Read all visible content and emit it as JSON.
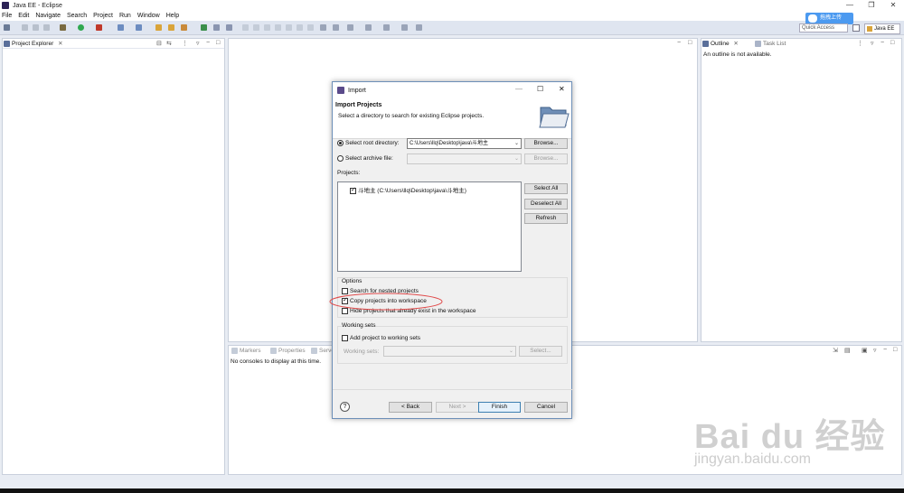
{
  "window": {
    "title": "Java EE - Eclipse",
    "minimize": "—",
    "maximize": "❐",
    "close": "✕"
  },
  "menu": [
    "File",
    "Edit",
    "Navigate",
    "Search",
    "Project",
    "Run",
    "Window",
    "Help"
  ],
  "toolbar": {
    "quick_access": "Quick Access",
    "upload_label": "拖拽上传",
    "perspective": "Java EE"
  },
  "panels": {
    "project_explorer": "Project Explorer",
    "outline_tab": "Outline",
    "task_list_tab": "Task List",
    "outline_message": "An outline is not available.",
    "markers_tab": "Markers",
    "properties_tab": "Properties",
    "servers_tab": "Serve",
    "console_message": "No consoles to display at this time."
  },
  "dialog": {
    "title": "Import",
    "heading": "Import Projects",
    "subtitle": "Select a directory to search for existing Eclipse projects.",
    "root_dir_label": "Select root directory:",
    "root_dir_value": "C:\\Users\\llq\\Desktop\\java\\斗地主",
    "archive_label": "Select archive file:",
    "archive_value": "",
    "browse": "Browse...",
    "projects_label": "Projects:",
    "project_item": "斗地主 (C:\\Users\\llq\\Desktop\\java\\斗地主)",
    "select_all": "Select All",
    "deselect_all": "Deselect All",
    "refresh": "Refresh",
    "options_label": "Options",
    "opt_nested": "Search for nested projects",
    "opt_copy": "Copy projects into workspace",
    "opt_hide": "Hide projects that already exist in the workspace",
    "working_sets_label": "Working sets",
    "add_to_ws": "Add project to working sets",
    "ws_label": "Working sets:",
    "select_btn": "Select...",
    "help": "?",
    "back": "< Back",
    "next": "Next >",
    "finish": "Finish",
    "cancel": "Cancel"
  },
  "watermark": {
    "main": "Bai du 经验",
    "url": "jingyan.baidu.com"
  }
}
